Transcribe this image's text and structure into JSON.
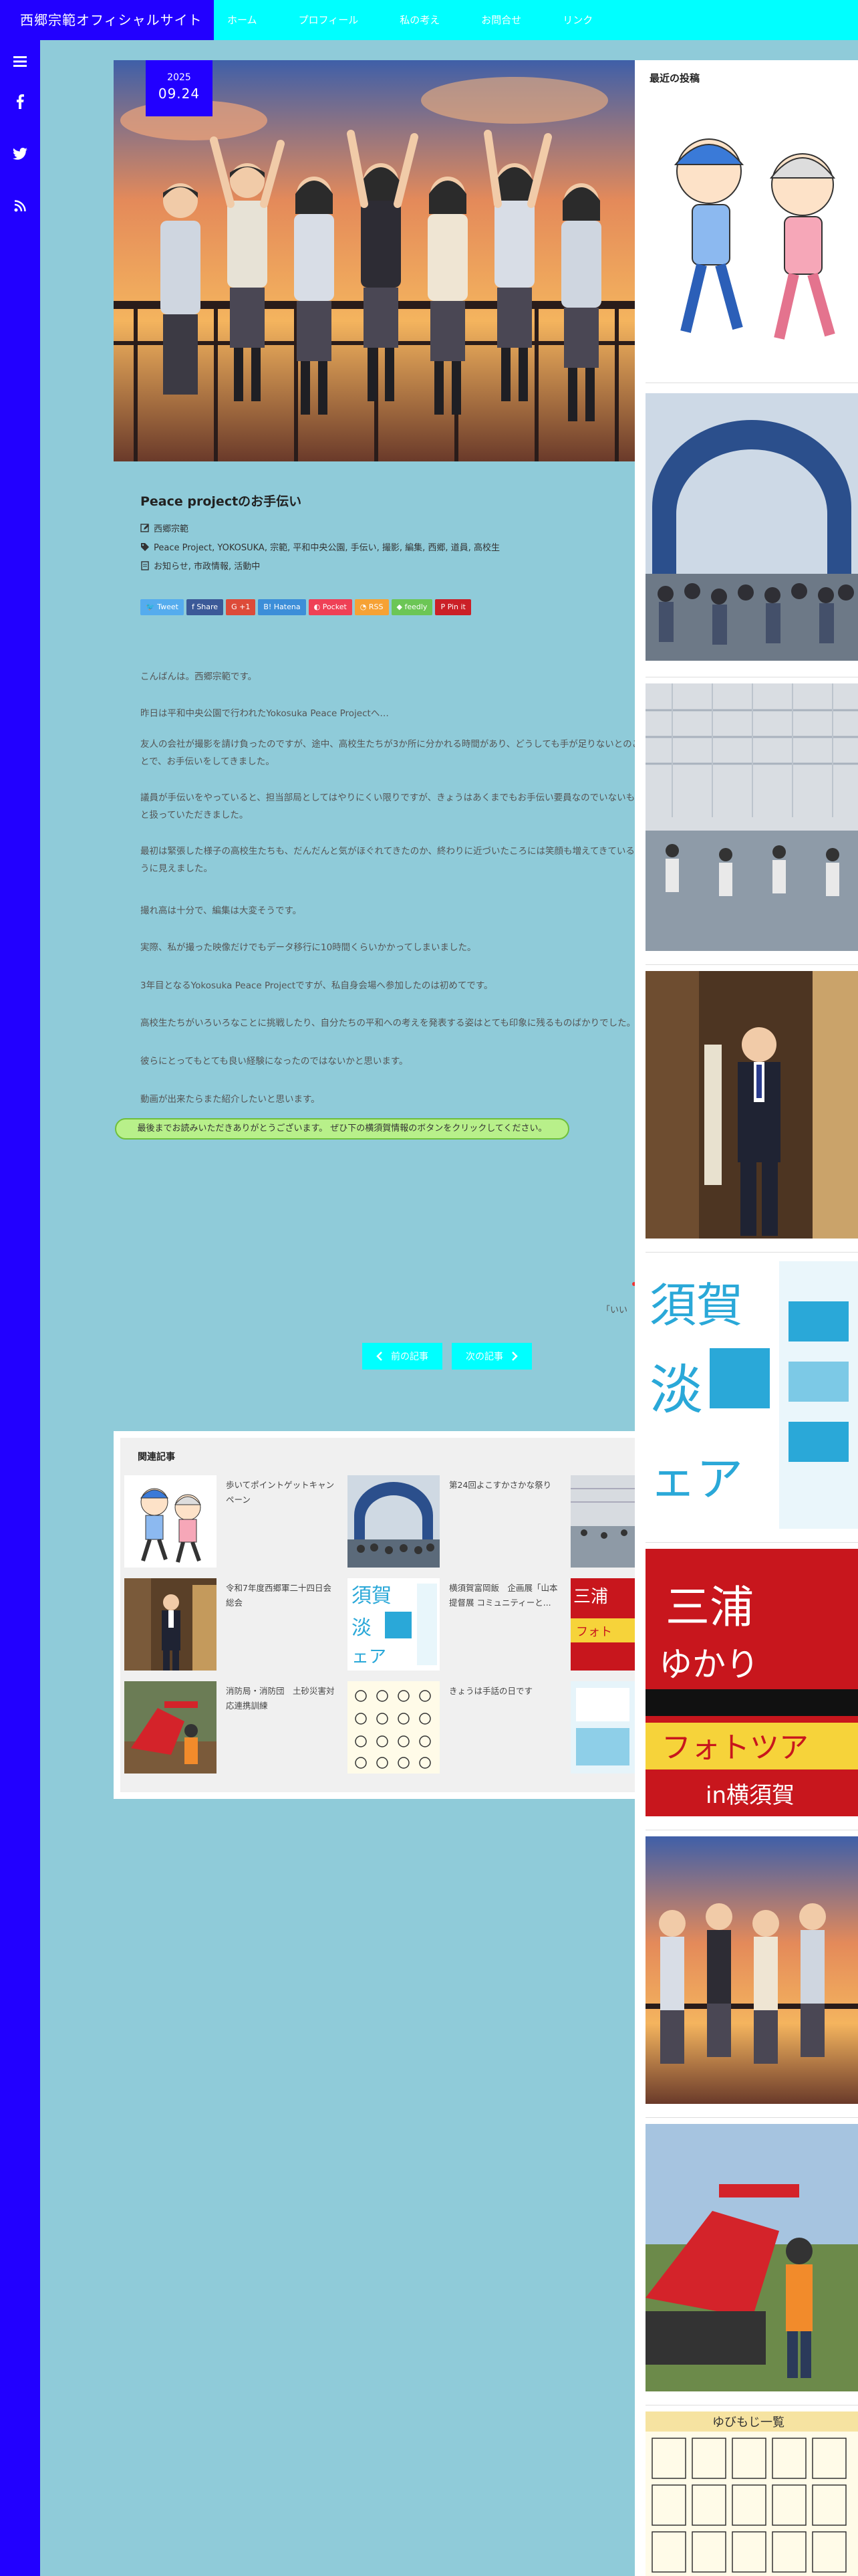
{
  "header": {
    "site_title": "西郷宗範オフィシャルサイト",
    "nav": [
      "ホーム",
      "プロフィール",
      "私の考え",
      "お問合せ",
      "リンク"
    ]
  },
  "left_bar": {
    "icons": [
      "menu-icon",
      "facebook-icon",
      "twitter-icon",
      "rss-icon"
    ]
  },
  "post": {
    "date_year": "2025",
    "date_md": "09.24",
    "title": "Peace projectのお手伝い",
    "author": "西郷宗範",
    "tags": "Peace Project, YOKOSUKA, 宗範, 平和中央公園, 手伝い, 撮影, 編集, 西郷, 道員, 高校生",
    "categories": "お知らせ, 市政情報, 活動中",
    "share": [
      "Tweet",
      "Share",
      "+1",
      "Hatena",
      "Pocket",
      "RSS",
      "feedly",
      "Pin it"
    ],
    "body": [
      "こんばんは。西郷宗範です。",
      "昨日は平和中央公園で行われたYokosuka Peace Projectへ…",
      "友人の会社が撮影を請け負ったのですが、途中、高校生たちが3か所に分かれる時間があり、どうしても手が足りないとのことで、お手伝いをしてきました。",
      "議員が手伝いをやっていると、担当部局としてはやりにくい限りですが、きょうはあくまでもお手伝い要員なのでいないものと扱っていただきました。",
      "最初は緊張した様子の高校生たちも、だんだんと気がほぐれてきたのか、終わりに近づいたころには笑顔も増えてきているように見えました。",
      "撮れ高は十分で、編集は大変そうです。",
      "実際、私が撮った映像だけでもデータ移行に10時間くらいかかってしまいました。",
      "3年目となるYokosuka Peace Projectですが、私自身会場へ参加したのは初めてです。",
      "高校生たちがいろいろなことに挑戦したり、自分たちの平和への考えを発表する姿はとても印象に残るものばかりでした。",
      "彼らにとってもとても良い経験になったのではないかと思います。",
      "動画が出来たらまた紹介したいと思います。"
    ],
    "cta": "最後までお読みいただきありがとうございます。 ぜひ下の横須賀情報のボタンをクリックしてください。",
    "iine": "「いい",
    "prev_label": "前の記事",
    "next_label": "次の記事"
  },
  "related": {
    "title": "関連記事",
    "items": [
      "歩いてポイントゲットキャンペーン",
      "第24回よこすかさかな祭り",
      "令和7年度西郷軍二十四日会総会",
      "横須賀富岡飯　企画展「山本提督展 コミュニティーと...",
      "消防局・消防団　土砂災害対応連携訓練",
      "きょうは手話の日です"
    ]
  },
  "sidebar": {
    "title": "最近の投稿"
  },
  "colors": {
    "accent_blue": "#2200ff",
    "accent_cyan": "#00ffff",
    "background": "#8fcbd9"
  }
}
